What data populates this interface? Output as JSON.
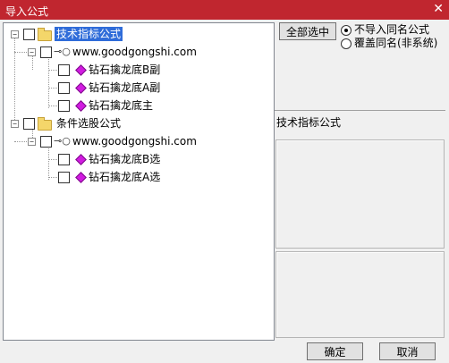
{
  "window": {
    "title": "导入公式",
    "close_glyph": "✕"
  },
  "tree": {
    "groups": [
      {
        "label": "技术指标公式",
        "source": "www.goodgongshi.com",
        "items": [
          "钻石擒龙底B副",
          "钻石擒龙底A副",
          "钻石擒龙底主"
        ]
      },
      {
        "label": "条件选股公式",
        "source": "www.goodgongshi.com",
        "items": [
          "钻石擒龙底B选",
          "钻石擒龙底A选"
        ]
      }
    ]
  },
  "options": {
    "select_all_label": "全部选中",
    "radio_no_import": "不导入同名公式",
    "radio_overwrite": "覆盖同名(非系统)",
    "selected": "不导入同名公式"
  },
  "info": {
    "type_label": "技术指标公式"
  },
  "footer": {
    "ok_label": "确定",
    "cancel_label": "取消"
  },
  "icons": {
    "expand": "minus-box",
    "folder": "folder-icon",
    "key": "key-icon",
    "formula": "gem-icon"
  },
  "colors": {
    "titlebar": "#c0262f",
    "selection": "#2f6cd9",
    "formula_gem": "#d11be0"
  }
}
